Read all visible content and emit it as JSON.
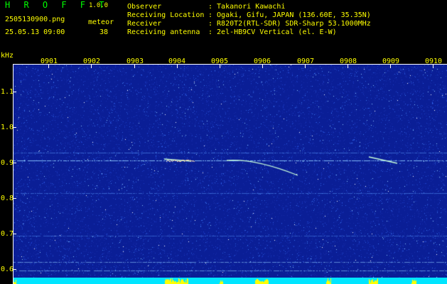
{
  "header": {
    "title": "H R O F F T",
    "version": "1.0.0",
    "filename": "2505130900.png",
    "datetime": "25.05.13 09:00",
    "meteor_label": "meteor",
    "meteor_count": "38"
  },
  "info": [
    {
      "label": "Observer",
      "value": ": Takanori Kawachi"
    },
    {
      "label": "Receiving Location",
      "value": ": Ogaki, Gifu, JAPAN (136.60E, 35.35N)"
    },
    {
      "label": "Receiver",
      "value": ": R820T2(RTL-SDR) SDR-Sharp 53.1000MHz"
    },
    {
      "label": "Receiving antenna",
      "value": ": 2el-HB9CV Vertical (el. E-W)"
    }
  ],
  "axis": {
    "y_unit": "kHz",
    "x_ticks": [
      "0901",
      "0902",
      "0903",
      "0904",
      "0905",
      "0906",
      "0907",
      "0908",
      "0909",
      "0910"
    ],
    "y_ticks": [
      "1.1",
      "1.0",
      "0.9",
      "0.8",
      "0.7",
      "0.6"
    ]
  },
  "colors": {
    "text": "#ffff00",
    "title": "#00ff00",
    "background": "#0a1e96",
    "level_bar": "#00e5ff",
    "burst": "#ffff00"
  }
}
